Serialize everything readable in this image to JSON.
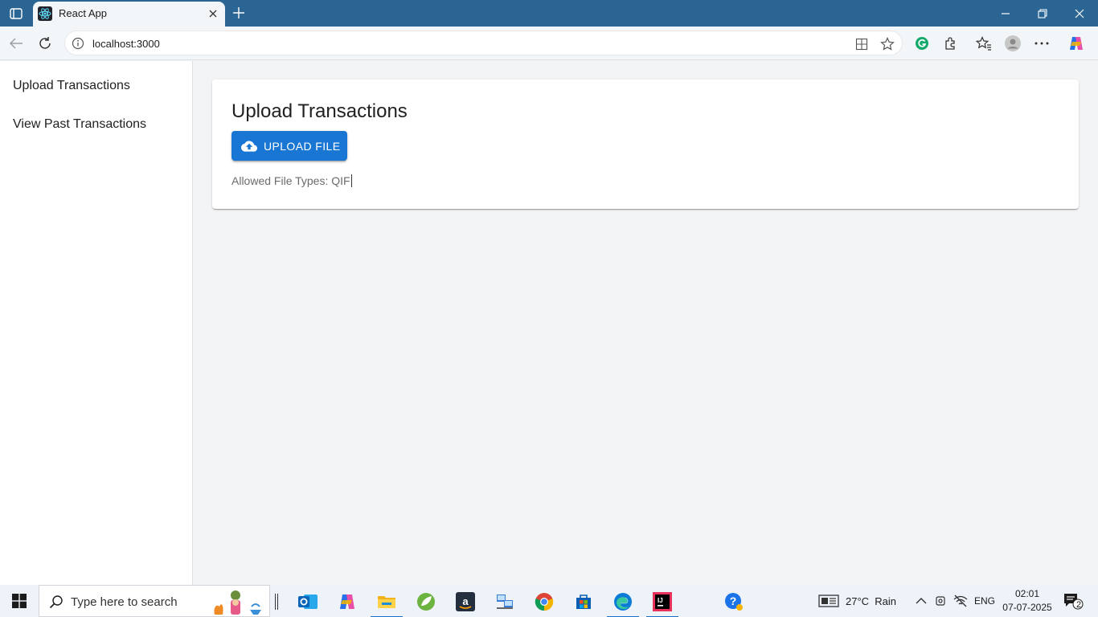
{
  "browser": {
    "tab_title": "React App",
    "url": "localhost:3000"
  },
  "sidebar": {
    "items": [
      {
        "label": "Upload Transactions"
      },
      {
        "label": "View Past Transactions"
      }
    ]
  },
  "main": {
    "title": "Upload Transactions",
    "upload_button_label": "UPLOAD FILE",
    "allowed_types_text": "Allowed File Types: QIF"
  },
  "taskbar": {
    "search_placeholder": "Type here to search",
    "weather": "27°C  Rain",
    "language": "ENG",
    "time": "02:01",
    "date": "07-07-2025",
    "notification_count": "2"
  },
  "colors": {
    "titlebar": "#2a6593",
    "primary_button": "#1976d2",
    "background": "#f3f4f6"
  }
}
